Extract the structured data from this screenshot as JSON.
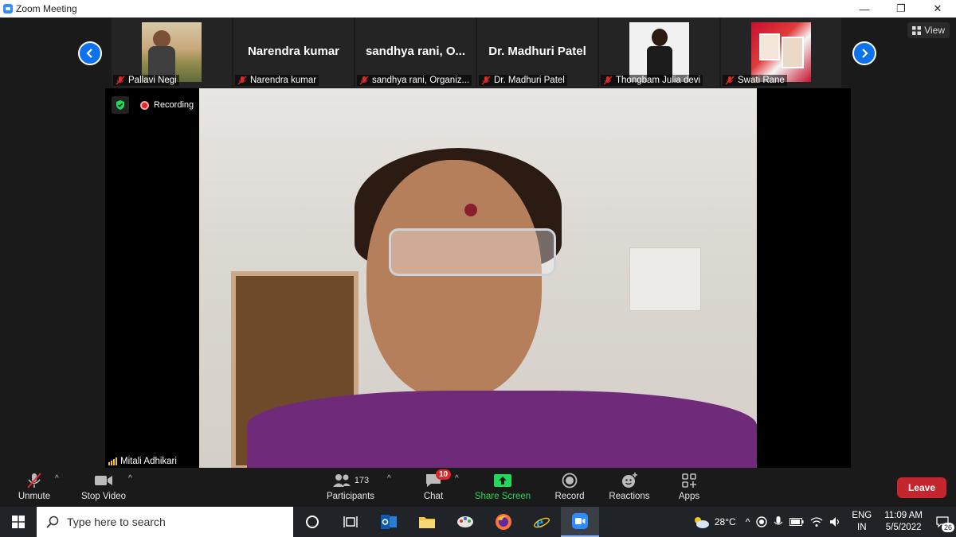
{
  "window": {
    "title": "Zoom Meeting",
    "controls": [
      "—",
      "❐",
      "✕"
    ]
  },
  "gallery": {
    "view_label": "View",
    "tiles": [
      {
        "type": "photo",
        "caption": "Pallavi Negi"
      },
      {
        "type": "name",
        "display_name": "Narendra kumar",
        "caption": "Narendra kumar"
      },
      {
        "type": "name",
        "display_name": "sandhya rani, O...",
        "caption": "sandhya rani, Organiz..."
      },
      {
        "type": "name",
        "display_name": "Dr. Madhuri Patel",
        "caption": "Dr. Madhuri Patel"
      },
      {
        "type": "photo",
        "caption": "Thongbam Julia devi"
      },
      {
        "type": "photo",
        "caption": "Swati Rane"
      }
    ]
  },
  "main_video": {
    "recording_label": "Recording",
    "speaker_name": "Mitali Adhikari"
  },
  "toolbar": {
    "unmute": "Unmute",
    "stop_video": "Stop Video",
    "participants": "Participants",
    "participants_count": "173",
    "chat": "Chat",
    "chat_badge": "10",
    "share_screen": "Share Screen",
    "record": "Record",
    "reactions": "Reactions",
    "apps": "Apps",
    "leave": "Leave"
  },
  "taskbar": {
    "search_placeholder": "Type here to search",
    "temperature": "28°C",
    "lang_top": "ENG",
    "lang_bottom": "IN",
    "time": "11:09 AM",
    "date": "5/5/2022",
    "notifications": "26"
  },
  "colors": {
    "accent_blue": "#0e72ed",
    "share_green": "#23d959",
    "leave_red": "#c4262d",
    "mic_off_red": "#e02828"
  }
}
